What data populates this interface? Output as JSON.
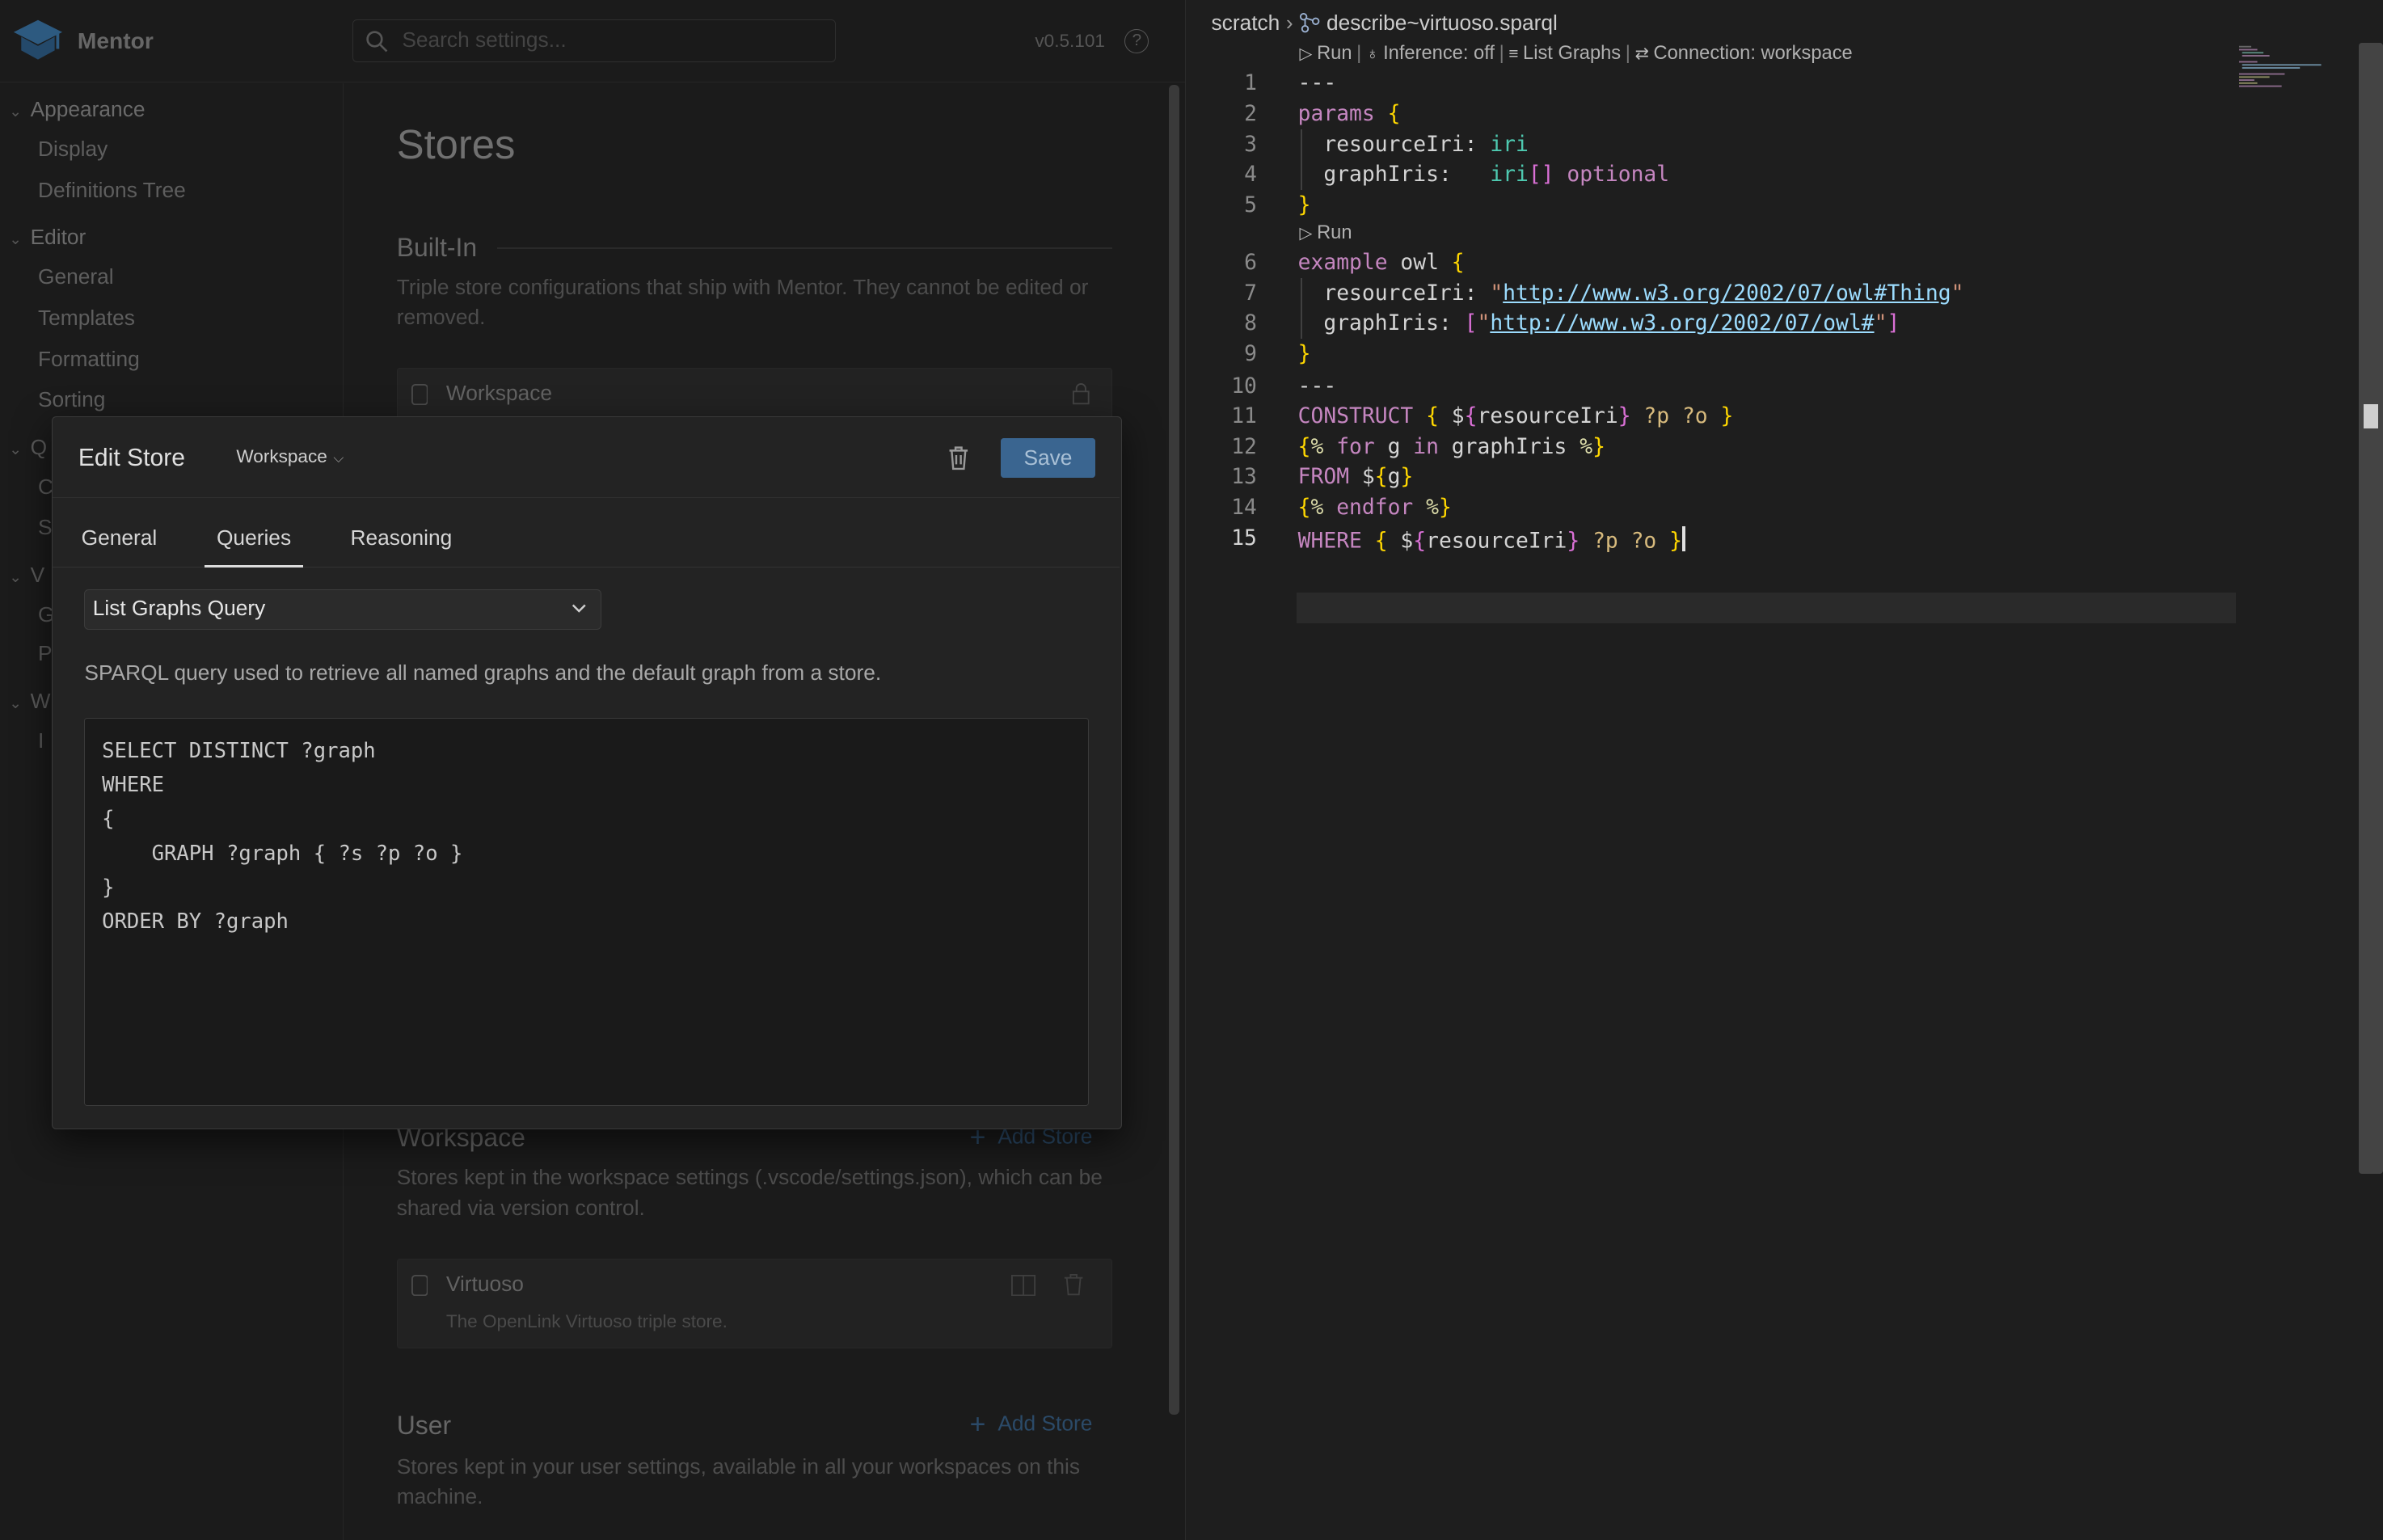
{
  "app": {
    "title": "Mentor",
    "version": "v0.5.101"
  },
  "search": {
    "placeholder": "Search settings..."
  },
  "nav": {
    "appearance": "Appearance",
    "display": "Display",
    "definitions_tree": "Definitions Tree",
    "editor": "Editor",
    "general": "General",
    "templates": "Templates",
    "formatting": "Formatting",
    "sorting": "Sorting",
    "frag_q": "Q",
    "frag_c": "C",
    "frag_s": "S",
    "frag_v": "V",
    "frag_g": "G",
    "frag_p": "P",
    "frag_w": "W",
    "frag_i": "I"
  },
  "stores": {
    "page_title": "Stores",
    "builtin_title": "Built-In",
    "builtin_desc": "Triple store configurations that ship with Mentor. They cannot be edited or removed.",
    "builtin_store": "Workspace",
    "workspace_title": "Workspace",
    "workspace_desc": "Stores kept in the workspace settings (.vscode/settings.json), which can be shared via version control.",
    "workspace_store_name": "Virtuoso",
    "workspace_store_desc": "The OpenLink Virtuoso triple store.",
    "user_title": "User",
    "user_desc": "Stores kept in your user settings, available in all your workspaces on this machine.",
    "add_store": "Add Store"
  },
  "modal": {
    "title": "Edit Store",
    "scope": "Workspace",
    "save": "Save",
    "tabs": [
      "General",
      "Queries",
      "Reasoning"
    ],
    "active_tab": "Queries",
    "query_select": "List Graphs Query",
    "query_desc": "SPARQL query used to retrieve all named graphs and the default graph from a store.",
    "query_text": "SELECT DISTINCT ?graph\nWHERE\n{\n    GRAPH ?graph { ?s ?p ?o }\n}\nORDER BY ?graph"
  },
  "editor": {
    "breadcrumb_root": "scratch",
    "breadcrumb_file": "describe~virtuoso.sparql",
    "codelens": {
      "run": "Run",
      "inference": "Inference: off",
      "list_graphs": "List Graphs",
      "connection": "Connection: workspace"
    },
    "run2": "Run",
    "line_numbers": [
      "1",
      "2",
      "3",
      "4",
      "5",
      "6",
      "7",
      "8",
      "9",
      "10",
      "11",
      "12",
      "13",
      "14",
      "15"
    ],
    "code": {
      "l1": "---",
      "l2_kw": "params",
      "l3_key": "resourceIri",
      "l3_type": "iri",
      "l4_key": "graphIris",
      "l4_type": "iri",
      "l4_brackets": "[]",
      "l4_opt": "optional",
      "l6_kw": "example",
      "l6_name": "owl",
      "l7_key": "resourceIri",
      "l7_url": "http://www.w3.org/2002/07/owl#Thing",
      "l8_key": "graphIris",
      "l8_url": "http://www.w3.org/2002/07/owl#",
      "l10": "---",
      "l11_kw": "CONSTRUCT",
      "var_resource": "resourceIri",
      "var_p": "?p",
      "var_o": "?o",
      "l12_for": "for",
      "l12_g": "g",
      "l12_in": "in",
      "l12_iter": "graphIris",
      "l13_kw": "FROM",
      "l13_var": "g",
      "l14_kw": "endfor",
      "l15_kw": "WHERE"
    }
  },
  "colors": {
    "keyword": "#c586c0",
    "type": "#4ec9b0",
    "bracket_gold": "#ffd700",
    "bracket_pink": "#da70d6",
    "string": "#ce9178",
    "link": "#9cdcfe",
    "save_button": "#3a6590"
  }
}
